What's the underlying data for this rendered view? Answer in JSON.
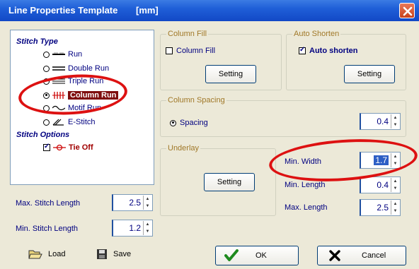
{
  "window": {
    "title": "Line Properties Template",
    "unit": "[mm]"
  },
  "tree": {
    "stitch_type_heading": "Stitch Type",
    "items": [
      {
        "label": "Run",
        "selected": false
      },
      {
        "label": "Double Run",
        "selected": false
      },
      {
        "label": "Triple Run",
        "selected": false
      },
      {
        "label": "Column Run",
        "selected": true
      },
      {
        "label": "Motif Run",
        "selected": false
      },
      {
        "label": "E-Stitch",
        "selected": false
      }
    ],
    "stitch_options_heading": "Stitch Options",
    "tie_off": {
      "label": "Tie Off",
      "checked": true
    }
  },
  "left_fields": {
    "max_stitch_length": {
      "label": "Max. Stitch Length",
      "value": "2.5"
    },
    "min_stitch_length": {
      "label": "Min. Stitch Length",
      "value": "1.2"
    }
  },
  "column_fill": {
    "title": "Column Fill",
    "checkbox_label": "Column Fill",
    "checked": false,
    "setting": "Setting"
  },
  "auto_shorten": {
    "title": "Auto Shorten",
    "checkbox_label": "Auto shorten",
    "checked": true,
    "setting": "Setting"
  },
  "column_spacing": {
    "title": "Column Spacing",
    "radio_label": "Spacing",
    "value": "0.4"
  },
  "underlay": {
    "title": "Underlay",
    "setting": "Setting"
  },
  "right_fields": {
    "min_width": {
      "label": "Min. Width",
      "value": "1.7"
    },
    "min_length": {
      "label": "Min. Length",
      "value": "0.4"
    },
    "max_length": {
      "label": "Max. Length",
      "value": "2.5"
    }
  },
  "footer": {
    "load": "Load",
    "save": "Save",
    "ok": "OK",
    "cancel": "Cancel"
  },
  "colors": {
    "title_bar": "#1f5fd8",
    "annotation": "#dd1111",
    "selected_item": "#7f0e0e"
  }
}
